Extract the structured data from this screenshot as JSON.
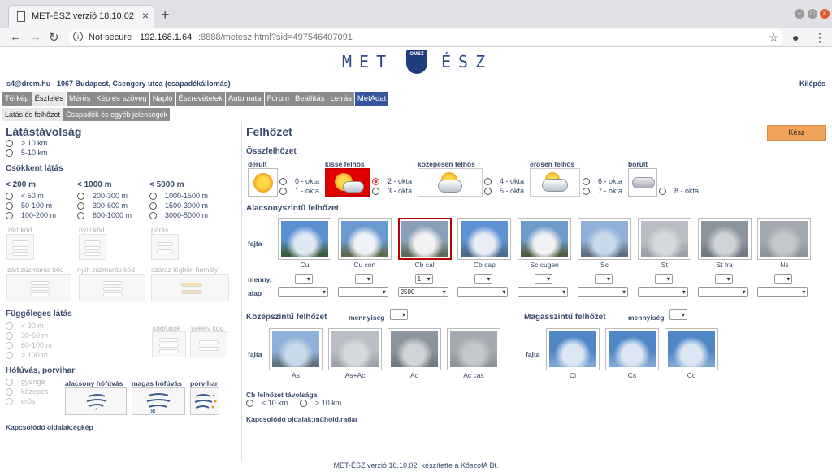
{
  "browser": {
    "tab_title": "MET-ÉSZ verzió 18.10.02",
    "not_secure": "Not secure",
    "url_host": "192.168.1.64",
    "url_rest": ":8888/metesz.html?sid=497546407091"
  },
  "brand": {
    "left": "MET",
    "right": "ÉSZ",
    "logo_text": "OMSZ"
  },
  "user": {
    "email": "s4@drem.hu",
    "station": "1067 Budapest, Csengery utca (csapadékállomás)",
    "logout": "Kilépés"
  },
  "menu": [
    "Térkép",
    "Észlelés",
    "Mérés",
    "Kép és szöveg",
    "Napló",
    "Észrevételek",
    "Automata",
    "Fórum",
    "Beállítás",
    "Leírás",
    "MetAdat"
  ],
  "submenu": [
    "Látás és felhőzet",
    "Csapadék és egyéb jelenségek"
  ],
  "left": {
    "visibility_title": "Látástávolság",
    "vis_options": [
      "> 10 km",
      "5-10 km"
    ],
    "reduced_title": "Csökkent látás",
    "col1": {
      "head": "< 200 m",
      "opts": [
        "< 50 m",
        "50-100 m",
        "100-200 m"
      ]
    },
    "col2": {
      "head": "< 1000 m",
      "opts": [
        "200-300 m",
        "300-600 m",
        "600-1000 m"
      ]
    },
    "col3": {
      "head": "< 5000 m",
      "opts": [
        "1000-1500 m",
        "1500-3000 m",
        "3000-5000 m"
      ]
    },
    "fog1": [
      "zárt köd",
      "nyílt köd",
      "párás"
    ],
    "fog2": [
      "zárt zúzmarás köd",
      "nyílt zúzmarás köd",
      "száraz légköri homály"
    ],
    "vertical_title": "Függőleges látás",
    "vert_opts": [
      "< 30 m",
      "30-60 m",
      "60-100 m",
      "> 100 m"
    ],
    "vert_icons": [
      "ködfoltok",
      "sekély köd"
    ],
    "snow_title": "Hófúvás, porvihar",
    "snow_opts": [
      "gyenge",
      "közepes",
      "erős"
    ],
    "snow_icons": [
      "alacsony hófúvás",
      "magas hófúvás",
      "porvihar"
    ],
    "related": "Kapcsolódó oldalak:égkép"
  },
  "right": {
    "title": "Felhőzet",
    "done": "Kész",
    "total_title": "Összfelhőzet",
    "cover_labels": [
      "derült",
      "kissé felhős",
      "közepesen felhős",
      "erősen felhős",
      "borult"
    ],
    "okta": [
      "0 - okta",
      "1 - okta",
      "2 - okta",
      "3 - okta",
      "4 - okta",
      "5 - okta",
      "6 - okta",
      "7 - okta",
      "8 - okta"
    ],
    "low_title": "Alacsonyszintű felhőzet",
    "kind": "fajta",
    "amount": "menny.",
    "base": "alap",
    "low_clouds": [
      "Cu",
      "Cu con",
      "Cb cal",
      "Cb cap",
      "Sc cugen",
      "Sc",
      "St",
      "St fra",
      "Ns"
    ],
    "low_amounts": [
      "",
      "",
      "1",
      "",
      "",
      "",
      "",
      "",
      ""
    ],
    "low_bases": [
      "",
      "",
      "2500",
      "",
      "",
      "",
      "",
      "",
      ""
    ],
    "mid_title": "Középszintű felhőzet",
    "mid_amount": "mennyiség",
    "mid_clouds": [
      "As",
      "As+Ac",
      "Ac",
      "Ac cas"
    ],
    "high_title": "Magasszintű felhőzet",
    "high_amount": "mennyiség",
    "high_clouds": [
      "Ci",
      "Cs",
      "Cc"
    ],
    "cb_title": "Cb felhőzet távolsága",
    "cb_opts": [
      "< 10 km",
      "> 10 km"
    ],
    "related": "Kapcsolódó oldalak:műhold,radar"
  },
  "footer": "MET-ÉSZ verzió 18.10.02, készítette a KőszofA Bt."
}
